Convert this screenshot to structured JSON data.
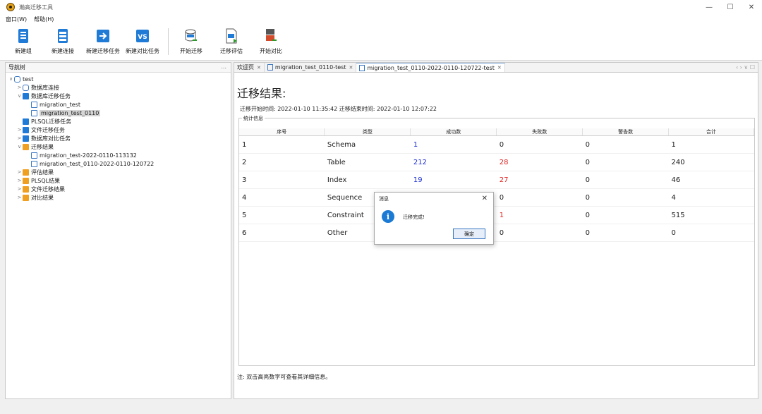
{
  "window": {
    "title": "瀚高迁移工具",
    "minimize": "—",
    "maximize": "☐",
    "close": "✕"
  },
  "menu": [
    "窗口(W)",
    "帮助(H)"
  ],
  "toolbar": [
    {
      "label": "新建组",
      "icon": "new-group-icon"
    },
    {
      "label": "新建连接",
      "icon": "new-connection-icon"
    },
    {
      "label": "新建迁移任务",
      "icon": "new-migration-task-icon"
    },
    {
      "label": "新建对比任务",
      "icon": "new-compare-task-icon"
    },
    {
      "label": "开始迁移",
      "icon": "start-migration-icon"
    },
    {
      "label": "迁移评估",
      "icon": "migration-eval-icon"
    },
    {
      "label": "开始对比",
      "icon": "start-compare-icon"
    }
  ],
  "nav": {
    "header": "导航树",
    "minimize": "...",
    "tree": [
      {
        "label": "test",
        "level": 0,
        "twisty": "∨",
        "icon": "db"
      },
      {
        "label": "数据库连接",
        "level": 1,
        "twisty": ">",
        "icon": "db"
      },
      {
        "label": "数据库迁移任务",
        "level": 1,
        "twisty": "∨",
        "icon": "blue"
      },
      {
        "label": "migration_test",
        "level": 2,
        "twisty": "",
        "icon": "doc"
      },
      {
        "label": "migration_test_0110",
        "level": 2,
        "twisty": "",
        "icon": "doc",
        "selected": true
      },
      {
        "label": "PLSQL迁移任务",
        "level": 1,
        "twisty": "",
        "icon": "blue"
      },
      {
        "label": "文件迁移任务",
        "level": 1,
        "twisty": ">",
        "icon": "blue"
      },
      {
        "label": "数据库对比任务",
        "level": 1,
        "twisty": ">",
        "icon": "blue"
      },
      {
        "label": "迁移结果",
        "level": 1,
        "twisty": "∨",
        "icon": "orange"
      },
      {
        "label": "migration_test-2022-0110-113132",
        "level": 2,
        "twisty": "",
        "icon": "doc"
      },
      {
        "label": "migration_test_0110-2022-0110-120722",
        "level": 2,
        "twisty": "",
        "icon": "doc"
      },
      {
        "label": "评估结果",
        "level": 1,
        "twisty": ">",
        "icon": "orange"
      },
      {
        "label": "PLSQL结果",
        "level": 1,
        "twisty": ">",
        "icon": "orange"
      },
      {
        "label": "文件迁移结果",
        "level": 1,
        "twisty": ">",
        "icon": "orange"
      },
      {
        "label": "对比结果",
        "level": 1,
        "twisty": ">",
        "icon": "orange"
      }
    ]
  },
  "tabs": [
    {
      "label": "欢迎页",
      "active": false
    },
    {
      "label": "migration_test_0110-test",
      "active": false
    },
    {
      "label": "migration_test_0110-2022-0110-120722-test",
      "active": true
    }
  ],
  "tab_nav": "‹ › ∨ ☐",
  "result": {
    "title": "迁移结果:",
    "times": "迁移开始时间: 2022-01-10 11:35:42  迁移结束时间: 2022-01-10 12:07:22",
    "legend": "统计信息",
    "columns": [
      "序号",
      "类型",
      "成功数",
      "失败数",
      "警告数",
      "合计"
    ],
    "rows": [
      {
        "no": "1",
        "type": "Schema",
        "success": "1",
        "fail": "0",
        "warn": "0",
        "total": "1",
        "success_color": "blue",
        "fail_color": ""
      },
      {
        "no": "2",
        "type": "Table",
        "success": "212",
        "fail": "28",
        "warn": "0",
        "total": "240",
        "success_color": "blue",
        "fail_color": "red"
      },
      {
        "no": "3",
        "type": "Index",
        "success": "19",
        "fail": "27",
        "warn": "0",
        "total": "46",
        "success_color": "blue",
        "fail_color": "red"
      },
      {
        "no": "4",
        "type": "Sequence",
        "success": "",
        "fail": "0",
        "warn": "0",
        "total": "4",
        "success_color": "",
        "fail_color": ""
      },
      {
        "no": "5",
        "type": "Constraint",
        "success": "",
        "fail": "1",
        "warn": "0",
        "total": "515",
        "success_color": "",
        "fail_color": "red"
      },
      {
        "no": "6",
        "type": "Other",
        "success": "",
        "fail": "0",
        "warn": "0",
        "total": "0",
        "success_color": "",
        "fail_color": ""
      }
    ],
    "note": "注: 双击高亮数字可查看其详细信息。"
  },
  "dialog": {
    "title": "消息",
    "message": "迁移完成!",
    "ok": "确定",
    "close": "✕",
    "info": "i"
  },
  "colors": {
    "accent": "#1f7bd6",
    "success": "#1d2fd6",
    "fail": "#e22222"
  }
}
